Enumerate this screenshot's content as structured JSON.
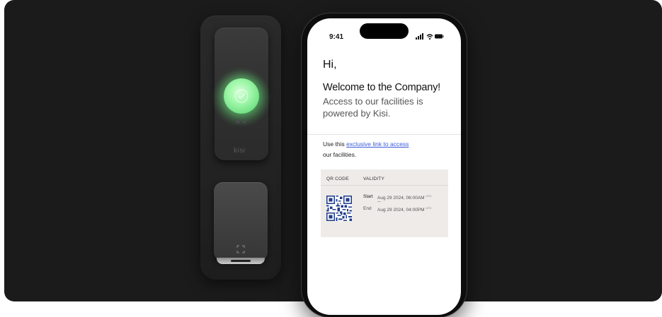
{
  "reader": {
    "brand": "kisi",
    "status_color": "#9df7a7"
  },
  "phone": {
    "status_bar": {
      "time": "9:41"
    },
    "greeting": "Hi,",
    "headline": "Welcome to the Company!",
    "subtext": "Access to our facilities is powered by Kisi.",
    "access": {
      "prefix": "Use this ",
      "link_label": "exclusive link to access",
      "suffix": "our facilities."
    },
    "pass_card": {
      "qr_header": "QR CODE",
      "validity_header": "VALIDITY",
      "start_label": "Start",
      "start_value": "Aug 29 2024, 06:00AM",
      "separator": "—",
      "end_label": "End",
      "end_value": "Aug 29 2024, 04:00PM",
      "tz": "UTC"
    }
  },
  "colors": {
    "link": "#3a5bd9",
    "card_bg": "#eeebe8",
    "background": "#1b1b1b"
  }
}
